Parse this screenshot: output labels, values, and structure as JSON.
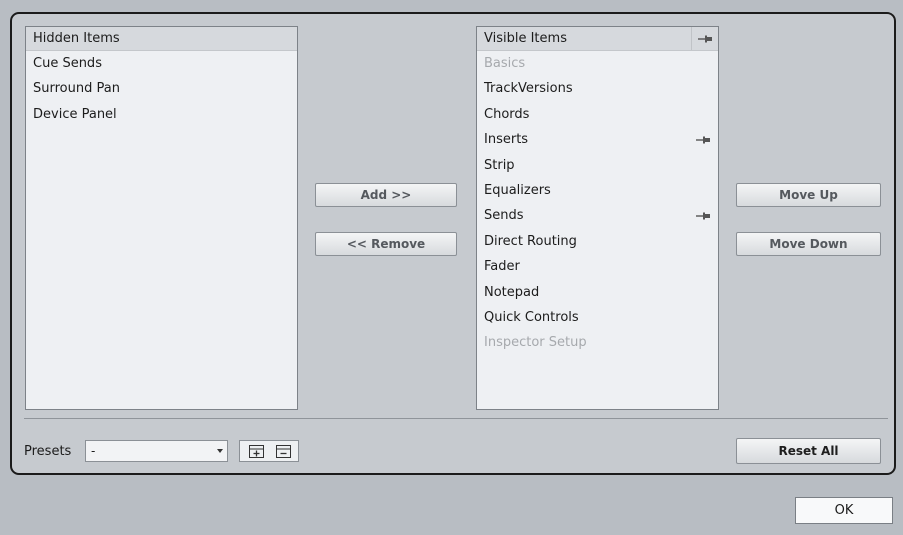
{
  "hidden_list": {
    "header": "Hidden Items",
    "items": [
      "Cue Sends",
      "Surround Pan",
      "Device Panel"
    ]
  },
  "visible_list": {
    "header": "Visible Items",
    "header_icon": "pin-icon",
    "items": [
      {
        "label": "Basics",
        "disabled": true,
        "pinned": false
      },
      {
        "label": "TrackVersions",
        "disabled": false,
        "pinned": false
      },
      {
        "label": "Chords",
        "disabled": false,
        "pinned": false
      },
      {
        "label": "Inserts",
        "disabled": false,
        "pinned": true
      },
      {
        "label": "Strip",
        "disabled": false,
        "pinned": false
      },
      {
        "label": "Equalizers",
        "disabled": false,
        "pinned": false
      },
      {
        "label": "Sends",
        "disabled": false,
        "pinned": true
      },
      {
        "label": "Direct Routing",
        "disabled": false,
        "pinned": false
      },
      {
        "label": "Fader",
        "disabled": false,
        "pinned": false
      },
      {
        "label": "Notepad",
        "disabled": false,
        "pinned": false
      },
      {
        "label": "Quick Controls",
        "disabled": false,
        "pinned": false
      },
      {
        "label": "Inspector Setup",
        "disabled": true,
        "pinned": false
      }
    ]
  },
  "buttons": {
    "add": "Add >>",
    "remove": "<< Remove",
    "move_up": "Move Up",
    "move_down": "Move Down",
    "reset_all": "Reset All",
    "ok": "OK"
  },
  "presets": {
    "label": "Presets",
    "selected": "-",
    "icons": [
      "save-preset-icon",
      "remove-preset-icon"
    ]
  }
}
